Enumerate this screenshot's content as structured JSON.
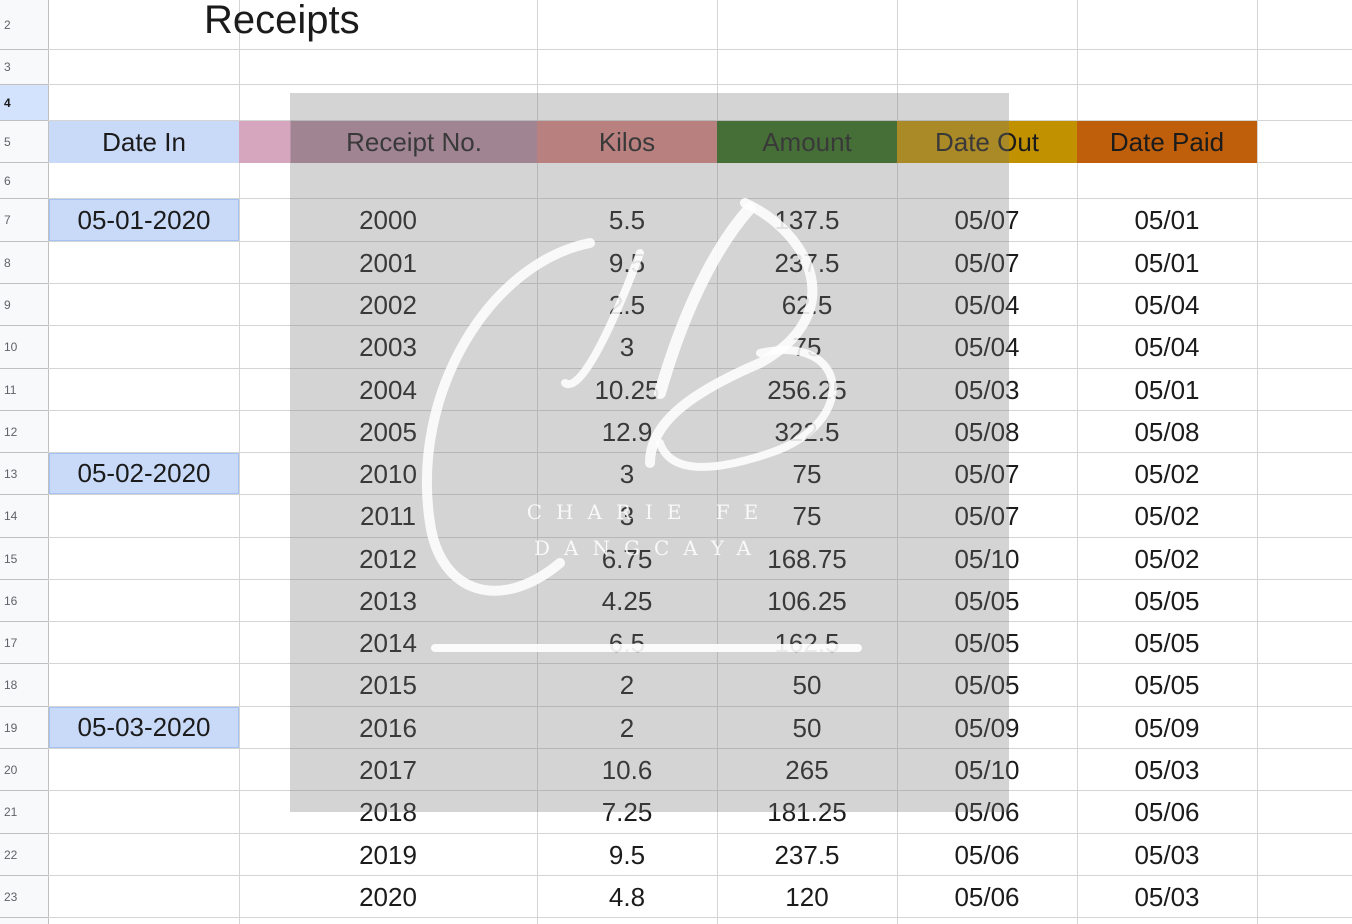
{
  "sheet": {
    "title": "Receipts",
    "row_numbers": [
      "2",
      "3",
      "4",
      "5",
      "6",
      "7",
      "8",
      "9",
      "10",
      "11",
      "12",
      "13",
      "14",
      "15",
      "16",
      "17",
      "18",
      "19",
      "20",
      "21",
      "22",
      "23"
    ],
    "selected_row": "4",
    "headers": {
      "date_in": "Date In",
      "receipt_no": "Receipt No.",
      "kilos": "Kilos",
      "amount": "Amount",
      "date_out": "Date Out",
      "date_paid": "Date Paid"
    },
    "header_colors": {
      "date_in": "#c9daf8",
      "blank": "#d5a6bd",
      "receipt_no": "#b48a9e",
      "kilos": "#d88484",
      "amount": "#2e6b1a",
      "date_out": "#c19100",
      "date_paid": "#bf5f0b"
    },
    "rows": [
      {
        "date_in": "05-01-2020",
        "receipt": "2000",
        "kilos": "5.5",
        "amount": "137.5",
        "date_out": "05/07",
        "date_paid": "05/01"
      },
      {
        "date_in": "",
        "receipt": "2001",
        "kilos": "9.5",
        "amount": "237.5",
        "date_out": "05/07",
        "date_paid": "05/01"
      },
      {
        "date_in": "",
        "receipt": "2002",
        "kilos": "2.5",
        "amount": "62.5",
        "date_out": "05/04",
        "date_paid": "05/04"
      },
      {
        "date_in": "",
        "receipt": "2003",
        "kilos": "3",
        "amount": "75",
        "date_out": "05/04",
        "date_paid": "05/04"
      },
      {
        "date_in": "",
        "receipt": "2004",
        "kilos": "10.25",
        "amount": "256.25",
        "date_out": "05/03",
        "date_paid": "05/01"
      },
      {
        "date_in": "",
        "receipt": "2005",
        "kilos": "12.9",
        "amount": "322.5",
        "date_out": "05/08",
        "date_paid": "05/08"
      },
      {
        "date_in": "05-02-2020",
        "receipt": "2010",
        "kilos": "3",
        "amount": "75",
        "date_out": "05/07",
        "date_paid": "05/02"
      },
      {
        "date_in": "",
        "receipt": "2011",
        "kilos": "3",
        "amount": "75",
        "date_out": "05/07",
        "date_paid": "05/02"
      },
      {
        "date_in": "",
        "receipt": "2012",
        "kilos": "6.75",
        "amount": "168.75",
        "date_out": "05/10",
        "date_paid": "05/02"
      },
      {
        "date_in": "",
        "receipt": "2013",
        "kilos": "4.25",
        "amount": "106.25",
        "date_out": "05/05",
        "date_paid": "05/05"
      },
      {
        "date_in": "",
        "receipt": "2014",
        "kilos": "6.5",
        "amount": "162.5",
        "date_out": "05/05",
        "date_paid": "05/05"
      },
      {
        "date_in": "",
        "receipt": "2015",
        "kilos": "2",
        "amount": "50",
        "date_out": "05/05",
        "date_paid": "05/05"
      },
      {
        "date_in": "05-03-2020",
        "receipt": "2016",
        "kilos": "2",
        "amount": "50",
        "date_out": "05/09",
        "date_paid": "05/09"
      },
      {
        "date_in": "",
        "receipt": "2017",
        "kilos": "10.6",
        "amount": "265",
        "date_out": "05/10",
        "date_paid": "05/03"
      },
      {
        "date_in": "",
        "receipt": "2018",
        "kilos": "7.25",
        "amount": "181.25",
        "date_out": "05/06",
        "date_paid": "05/06"
      },
      {
        "date_in": "",
        "receipt": "2019",
        "kilos": "9.5",
        "amount": "237.5",
        "date_out": "05/06",
        "date_paid": "05/03"
      },
      {
        "date_in": "",
        "receipt": "2020",
        "kilos": "4.8",
        "amount": "120",
        "date_out": "05/06",
        "date_paid": "05/03"
      }
    ]
  },
  "watermark": {
    "line1": "CHARIE FE",
    "line2": "DANGCAYA"
  }
}
